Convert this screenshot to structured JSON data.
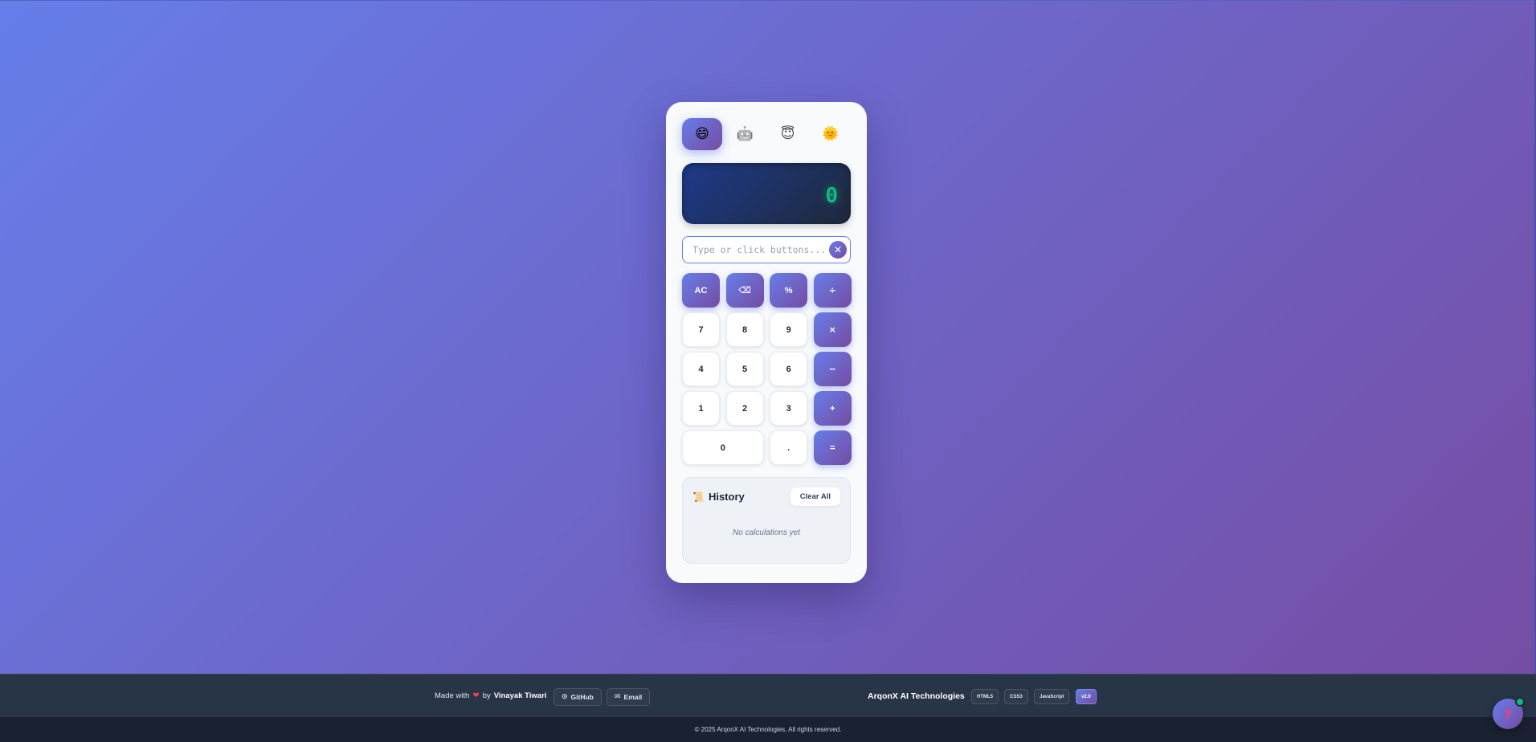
{
  "themes": [
    {
      "name": "happy",
      "emoji": "😄",
      "active": true
    },
    {
      "name": "robot",
      "emoji": "🤖",
      "active": false
    },
    {
      "name": "angel",
      "emoji": "😇",
      "active": false
    },
    {
      "name": "sun",
      "emoji": "🌞",
      "active": false
    }
  ],
  "display": {
    "value": "0"
  },
  "input": {
    "placeholder": "Type or click buttons...",
    "clear_symbol": "✕"
  },
  "keys": {
    "ac": "AC",
    "backspace": "⌫",
    "percent": "%",
    "divide": "÷",
    "seven": "7",
    "eight": "8",
    "nine": "9",
    "multiply": "×",
    "four": "4",
    "five": "5",
    "six": "6",
    "minus": "−",
    "one": "1",
    "two": "2",
    "three": "3",
    "plus": "+",
    "zero": "0",
    "dot": ".",
    "equals": "="
  },
  "history": {
    "icon": "📜",
    "title": "History",
    "clear_label": "Clear All",
    "empty_text": "No calculations yet"
  },
  "footer": {
    "made_with": "Made with",
    "heart": "❤",
    "by": "by",
    "author": "Vinayak Tiwari",
    "github_icon": "⊙",
    "github_label": "GitHub",
    "email_icon": "✉",
    "email_label": "Email",
    "company": "ArqonX AI Technologies",
    "badges": [
      "HTML5",
      "CSS3",
      "JavaScript",
      "v2.0"
    ],
    "copyright": "© 2025 ArqonX AI Technologies. All rights reserved."
  },
  "help": {
    "symbol": "?"
  },
  "colors": {
    "accent_start": "#667eea",
    "accent_end": "#764ba2",
    "display_text": "#10b981",
    "footer_bg": "#283546"
  }
}
